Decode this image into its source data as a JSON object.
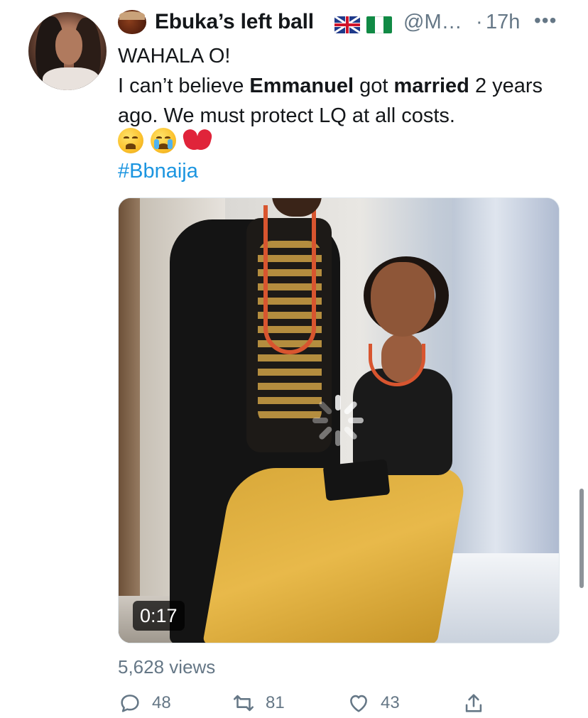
{
  "author": {
    "display_name": "Ebuka’s left ball",
    "handle": "@M…",
    "separator": "·",
    "timestamp": "17h",
    "more_label": "•••"
  },
  "tweet": {
    "line1": "WAHALA O!",
    "line2_pre": "I can’t believe ",
    "line2_bold1": "Emmanuel",
    "line2_mid": " got ",
    "line2_bold2": "married",
    "line2_post": " 2 years ago. We must protect LQ at all costs.",
    "emojis": [
      "weary-face",
      "loudly-crying-face",
      "broken-heart"
    ],
    "hashtag": "#Bbnaija"
  },
  "media": {
    "duration": "0:17",
    "loading": true
  },
  "stats": {
    "views": "5,628 views",
    "replies": "48",
    "retweets": "81",
    "likes": "43"
  },
  "icons": {
    "reply": "reply-icon",
    "retweet": "retweet-icon",
    "like": "heart-icon",
    "share": "share-icon"
  },
  "colors": {
    "link": "#1b95e0",
    "secondary_text": "#657786",
    "primary_text": "#14171a"
  }
}
